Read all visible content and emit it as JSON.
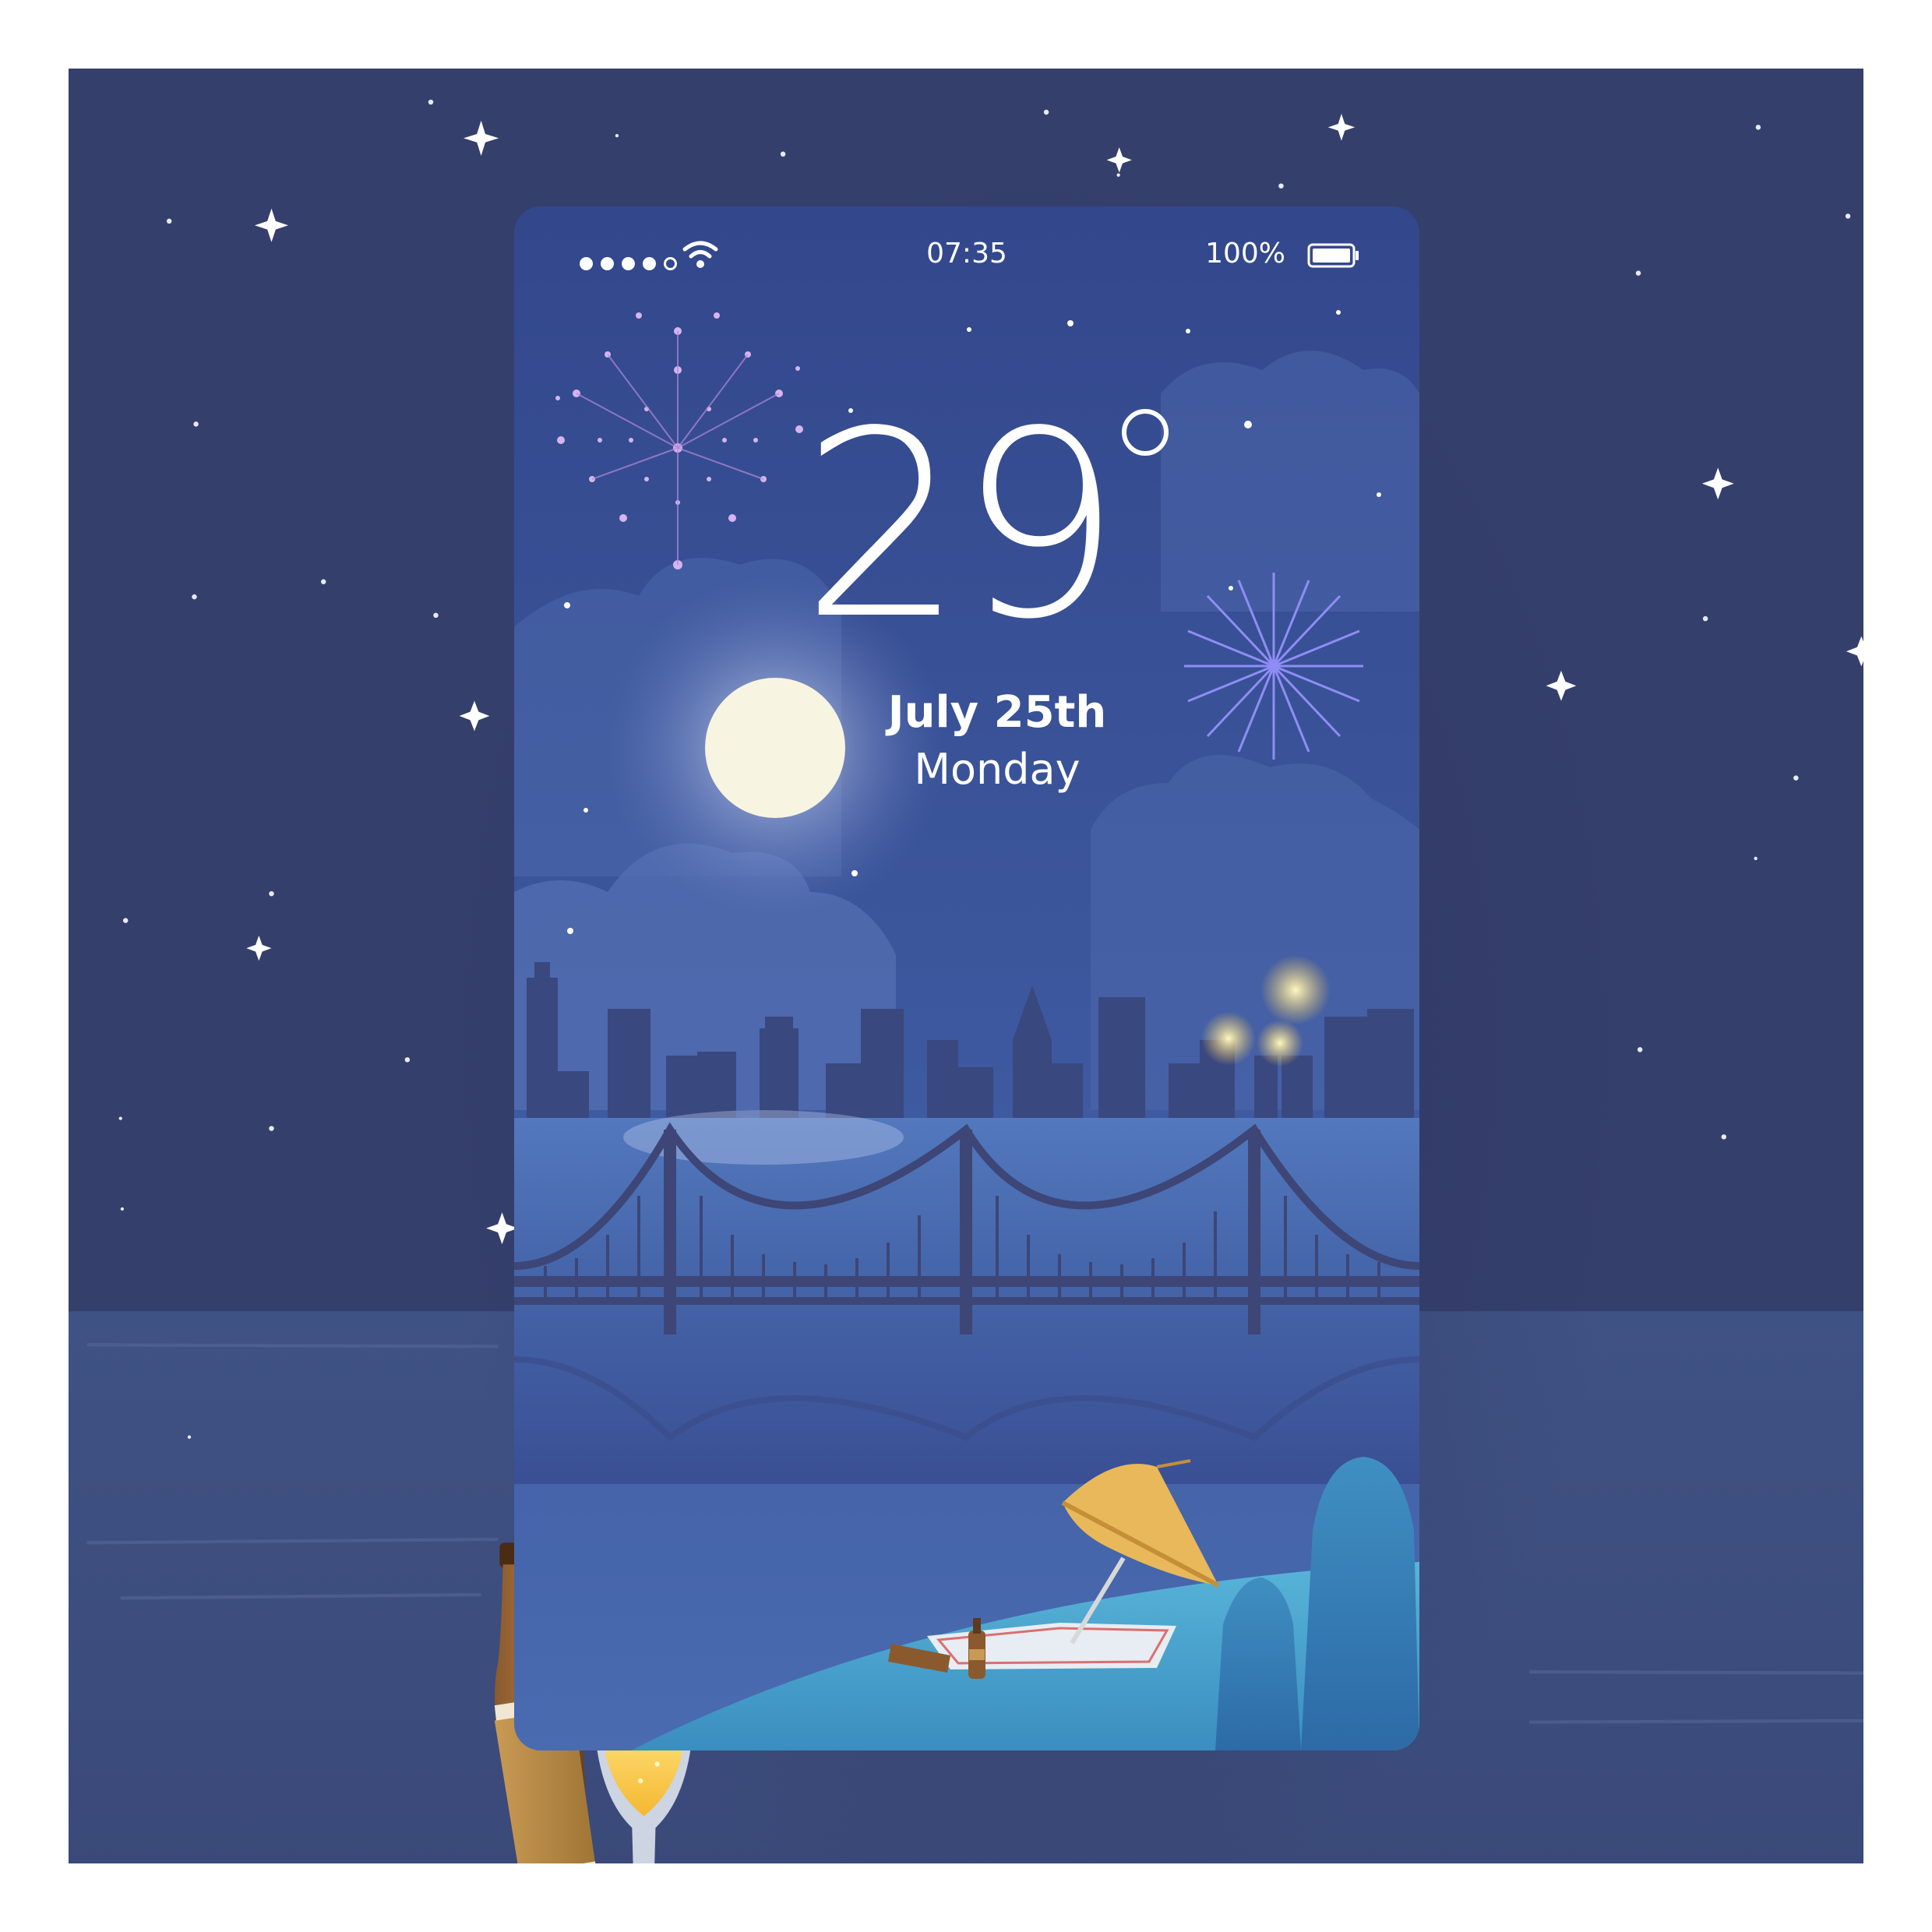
{
  "status_bar": {
    "signal_dots_filled": 4,
    "signal_dots_total": 5,
    "wifi_icon": "wifi-icon",
    "time": "07:35",
    "battery_percent": "100%",
    "battery_icon": "battery-full-icon"
  },
  "weather": {
    "temperature": "29",
    "date": "July 25th",
    "weekday": "Monday"
  },
  "colors": {
    "background": "#353f6c",
    "phone_sky_top": "#33478c",
    "phone_sky_bottom": "#4463a8",
    "river": "#4f73b8",
    "city": "#3a4880",
    "bridge": "#3d4677",
    "grass": "#4aa3cb",
    "moon": "#f7f4e1"
  }
}
